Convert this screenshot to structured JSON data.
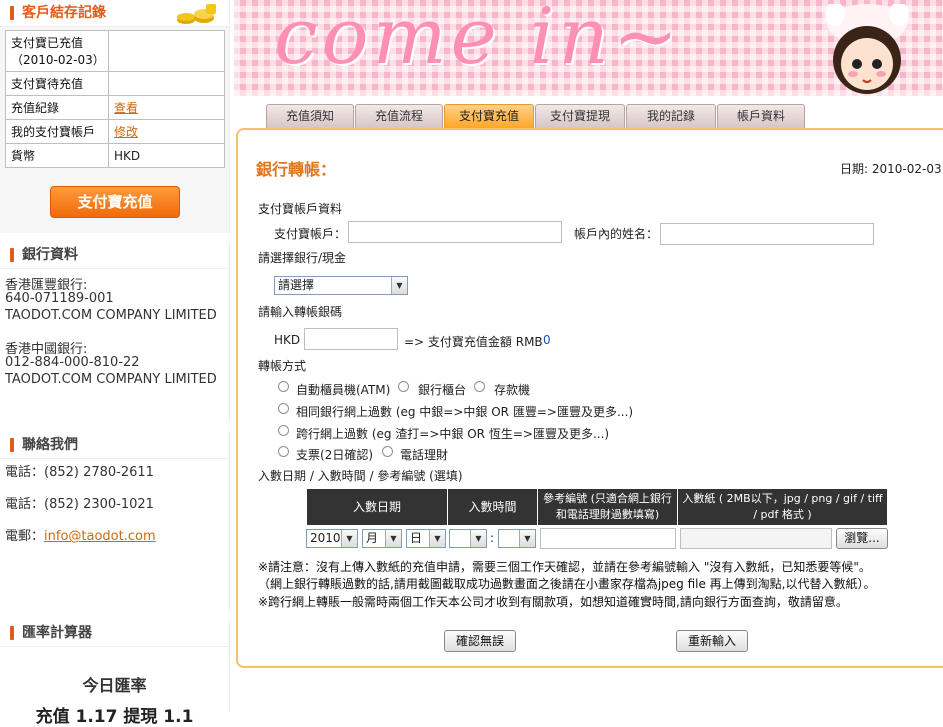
{
  "sidebar": {
    "account_panel": {
      "title": "客戶結存記錄",
      "rows": [
        {
          "label": "支付寶已充值（2010-02-03）",
          "value": ""
        },
        {
          "label": "支付寶待充值",
          "value": ""
        },
        {
          "label": "充值紀錄",
          "value": "查看"
        },
        {
          "label": "我的支付寶帳戶",
          "value": "修改"
        },
        {
          "label": "貨幣",
          "value": "HKD"
        }
      ],
      "topup_button": "支付寶充值"
    },
    "bank_panel": {
      "title": "銀行資料",
      "lines": [
        "香港匯豐銀行:",
        "640-071189-001",
        "TAODOT.COM COMPANY LIMITED",
        "香港中國銀行:",
        "012-884-000-810-22",
        "TAODOT.COM COMPANY LIMITED"
      ]
    },
    "contact_panel": {
      "title": "聯絡我們",
      "phone1": "電話：(852) 2780-2611",
      "phone2": "電話：(852) 2300-1021",
      "email_label": "電郵：",
      "email": "info@taodot.com"
    },
    "rate_panel": {
      "title": "匯率計算器",
      "heading": "今日匯率",
      "rate_line": "充值 1.17  提現 1.1"
    }
  },
  "banner": {
    "text": "come in~"
  },
  "tabs": [
    {
      "label": "充值須知",
      "active": false
    },
    {
      "label": "充值流程",
      "active": false
    },
    {
      "label": "支付寶充值",
      "active": true
    },
    {
      "label": "支付寶提現",
      "active": false
    },
    {
      "label": "我的記錄",
      "active": false
    },
    {
      "label": "帳戶資料",
      "active": false
    }
  ],
  "form": {
    "title": "銀行轉帳：",
    "date": "日期: 2010-02-03",
    "alipay_section": "支付寶帳戶資料",
    "alipay_account_label": "支付寶帳戶：",
    "account_name_label": "帳戶內的姓名：",
    "bank_section": "請選擇銀行/現金",
    "bank_select_value": "請選擇",
    "amount_section": "請輸入轉帳銀碼",
    "currency": "HKD",
    "convert_text": "=> 支付寶充值金額 RMB",
    "rmb_value": "0",
    "method_section": "轉帳方式",
    "methods": {
      "atm": "自動櫃員機(ATM)",
      "counter": "銀行櫃台",
      "deposit": "存款機",
      "same_bank": "相同銀行網上過數 (eg 中銀=>中銀 OR 匯豐=>匯豐及更多...)",
      "cross_bank": "跨行網上過數 (eg 渣打=>中銀 OR 恆生=>匯豐及更多...)",
      "cheque": "支票(2日確認)",
      "phone": "電話理財"
    },
    "entry_section": "入數日期 / 入數時間 / 參考編號 (選填)",
    "table_headers": [
      "入數日期",
      "入數時間",
      "參考編號 (只適合網上銀行和電話理財過數填寫)",
      "入數紙 ( 2MB以下，jpg / png / gif / tiff / pdf 格式 )"
    ],
    "year_value": "2010",
    "month_value": "月",
    "day_value": "日",
    "time_sep": ":",
    "browse_button": "瀏覽...",
    "notes": [
      "※請注意：沒有上傳入數紙的充值申請，需要三個工作天確認，並請在參考編號輸入 \"沒有入數紙，已知悉要等候\"。",
      "（網上銀行轉賬過數的話,請用截圖截取成功過數畫面之後請在小畫家存檔為jpeg file 再上傳到淘點,以代替入數紙）。",
      "※跨行網上轉賬一般需時兩個工作天本公司才收到有關款項，如想知道確實時間,請向銀行方面查詢，敬請留意。"
    ],
    "confirm_button": "確認無誤",
    "reset_button": "重新輸入"
  },
  "colors": {
    "accent": "#e2771c",
    "tab_active": "#ffa726",
    "content_border": "#f2c266",
    "link": "#c86b14"
  }
}
